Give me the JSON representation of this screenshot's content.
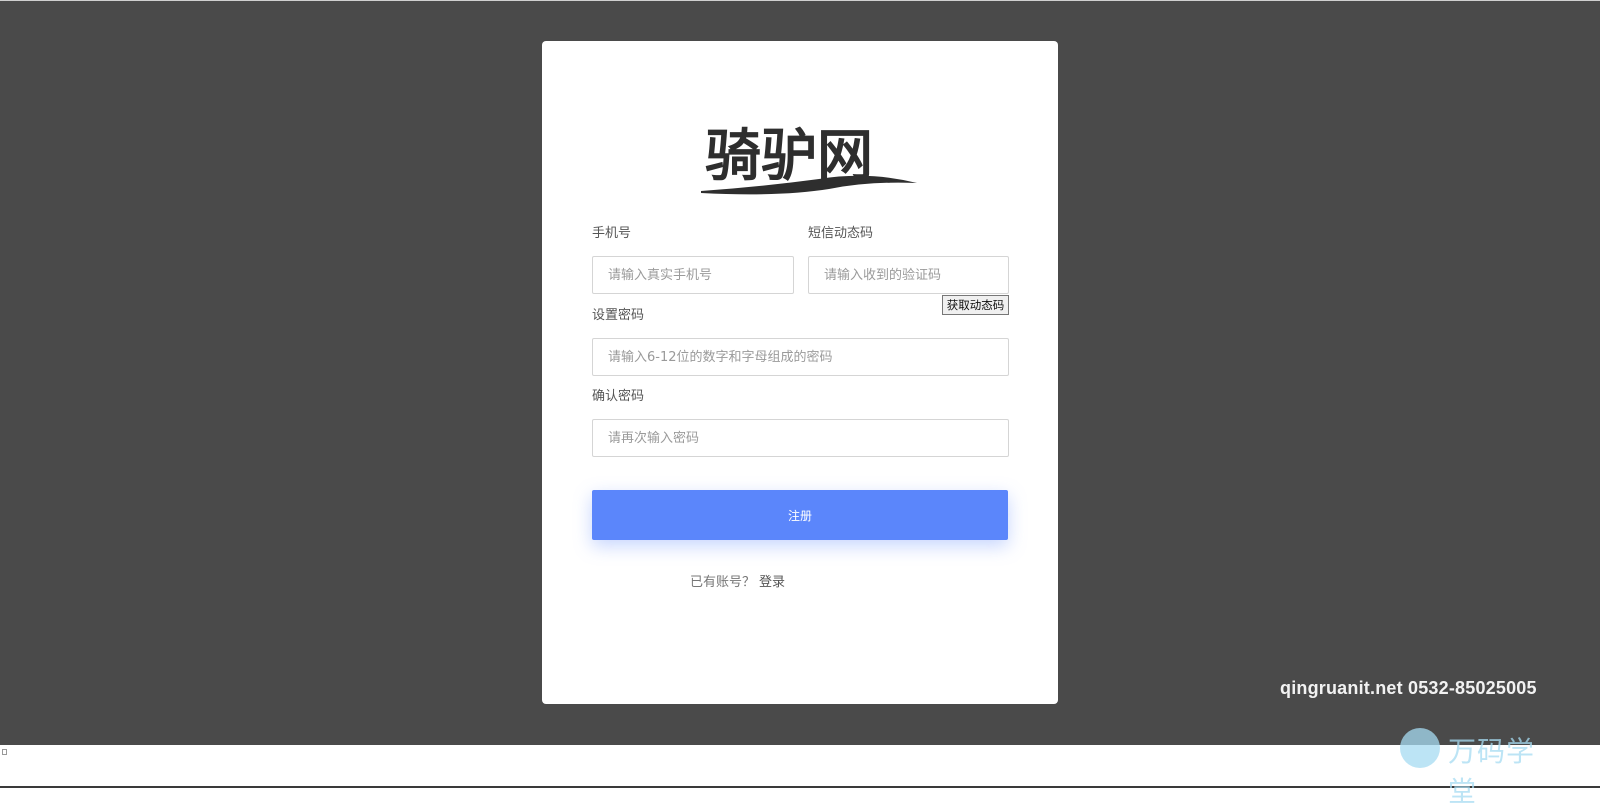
{
  "logo": {
    "text": "骑驴网"
  },
  "form": {
    "phone_label": "手机号",
    "phone_placeholder": "请输入真实手机号",
    "sms_label": "短信动态码",
    "sms_placeholder": "请输入收到的验证码",
    "get_code_label": "获取动态码",
    "password_label": "设置密码",
    "password_placeholder": "请输入6-12位的数字和字母组成的密码",
    "confirm_label": "确认密码",
    "confirm_placeholder": "请再次输入密码",
    "submit_label": "注册"
  },
  "footer": {
    "have_account": "已有账号？",
    "login_link": "登录"
  },
  "watermark": {
    "text": "qingruanit.net 0532-85025005",
    "brand": "万码学堂"
  },
  "colors": {
    "backdrop": "#4a4a4a",
    "card": "#ffffff",
    "primary": "#5b86fb",
    "brand": "#a6dcf2"
  }
}
